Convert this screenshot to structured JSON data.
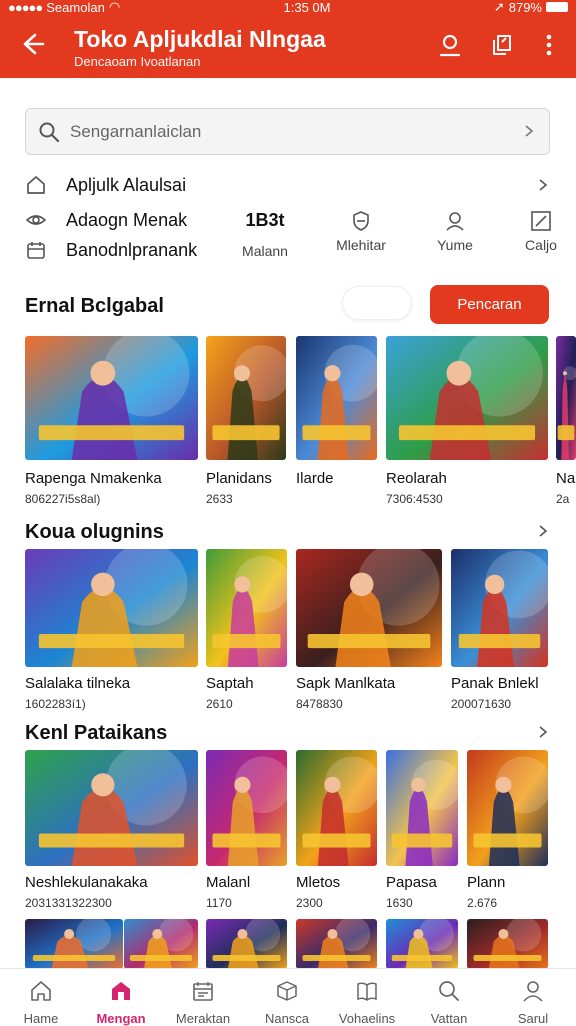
{
  "status": {
    "carrier": "Seamolan",
    "time": "1:35 0M",
    "battery": "879%"
  },
  "app": {
    "title": "Toko Apljukdlai Nlngaa",
    "subtitle": "Dencaoam Ivoatlanan"
  },
  "search": {
    "placeholder": "Sengarnanlaiclan"
  },
  "info_rows": [
    {
      "icon": "home-icon",
      "label": "Apljulk Alaulsai"
    },
    {
      "icon": "eye-icon",
      "label": "Adaogn Menak"
    },
    {
      "icon": "calendar-icon",
      "label": "Banodnlpranank"
    }
  ],
  "quick": {
    "value": "1B3t",
    "items": [
      {
        "icon": "",
        "label": "Malann"
      },
      {
        "icon": "shield-icon",
        "label": "Mlehitar"
      },
      {
        "icon": "user-icon",
        "label": "Yume"
      },
      {
        "icon": "edit-icon",
        "label": "Caljo"
      }
    ]
  },
  "sections": [
    {
      "title": "Ernal Bclgabal",
      "button": "Pencaran",
      "items": [
        {
          "name": "Rapenga Nmakenka",
          "meta": "806227i5s8al)",
          "colors": [
            "#f26d2a",
            "#6a2da8",
            "#1d9be0"
          ]
        },
        {
          "name": "Planidans",
          "meta": "2633",
          "colors": [
            "#f7a21b",
            "#2b3a1a",
            "#b8562a"
          ]
        },
        {
          "name": "Ilarde",
          "meta": "",
          "colors": [
            "#1a3670",
            "#e86b1d",
            "#4d8ad6"
          ]
        },
        {
          "name": "Reolarah",
          "meta": "7306:4530",
          "colors": [
            "#3aa2d8",
            "#c62f2f",
            "#2e9d48"
          ]
        },
        {
          "name": "Na",
          "meta": "2a",
          "colors": [
            "#7b2ca0",
            "#e43b6a",
            "#1f1f55"
          ]
        }
      ]
    },
    {
      "title": "Koua olugnins",
      "items": [
        {
          "name": "Salalaka tilneka",
          "meta": "1602283í1)",
          "colors": [
            "#6b3bb8",
            "#f2a018",
            "#1c86d1"
          ]
        },
        {
          "name": "Saptah",
          "meta": "2610",
          "colors": [
            "#3f9c39",
            "#c83c9d",
            "#f2c21b"
          ]
        },
        {
          "name": "Sapk Manlkata",
          "meta": "8478830",
          "colors": [
            "#a8281f",
            "#f2821b",
            "#3a1f1f"
          ]
        },
        {
          "name": "Panak Bnlekl",
          "meta": "200071630",
          "colors": [
            "#1d2e6b",
            "#d6331f",
            "#3a8fd6"
          ]
        }
      ]
    },
    {
      "title": "Kenl Pataikans",
      "items": [
        {
          "name": "Neshlekulanakaka",
          "meta": "2031331322300",
          "colors": [
            "#2fa24b",
            "#e0522a",
            "#2d6fc2"
          ]
        },
        {
          "name": "Malanl",
          "meta": "1170",
          "colors": [
            "#7b2ab5",
            "#e8a12a",
            "#c7296d"
          ]
        },
        {
          "name": "Mletos",
          "meta": "2300",
          "colors": [
            "#2a6b2f",
            "#c42d2d",
            "#f2a21b"
          ]
        },
        {
          "name": "Papasa",
          "meta": "1630",
          "colors": [
            "#3b6fe0",
            "#8a2bc4",
            "#f2c44b"
          ]
        },
        {
          "name": "Plann",
          "meta": "2.676",
          "colors": [
            "#c23a1f",
            "#1f2e5a",
            "#f2a01b"
          ]
        }
      ]
    },
    {
      "items": [
        {
          "colors": [
            "#2c1a4a",
            "#f06e2b",
            "#1f72c8"
          ]
        },
        {
          "colors": [
            "#2e8fd0",
            "#f2a21b",
            "#b22a6e"
          ]
        },
        {
          "colors": [
            "#7b2ab5",
            "#f2a21b",
            "#1f2e5a"
          ]
        },
        {
          "colors": [
            "#c93a2a",
            "#f2821b",
            "#3a2a6b"
          ]
        },
        {
          "colors": [
            "#1f8fd8",
            "#f2c21b",
            "#6b2ab5"
          ]
        },
        {
          "colors": [
            "#2a1f1f",
            "#e8731b",
            "#9e2a2a"
          ]
        }
      ]
    }
  ],
  "nav": [
    {
      "icon": "home-icon",
      "label": "Hame"
    },
    {
      "icon": "store-icon",
      "label": "Mengan",
      "active": true
    },
    {
      "icon": "calendar-icon",
      "label": "Meraktan"
    },
    {
      "icon": "box-icon",
      "label": "Nansca"
    },
    {
      "icon": "book-icon",
      "label": "Vohaelins"
    },
    {
      "icon": "search-icon",
      "label": "Vattan"
    },
    {
      "icon": "user-icon",
      "label": "Sarul"
    }
  ],
  "theme": {
    "accent": "#e2391f",
    "active_nav": "#d6246e"
  }
}
